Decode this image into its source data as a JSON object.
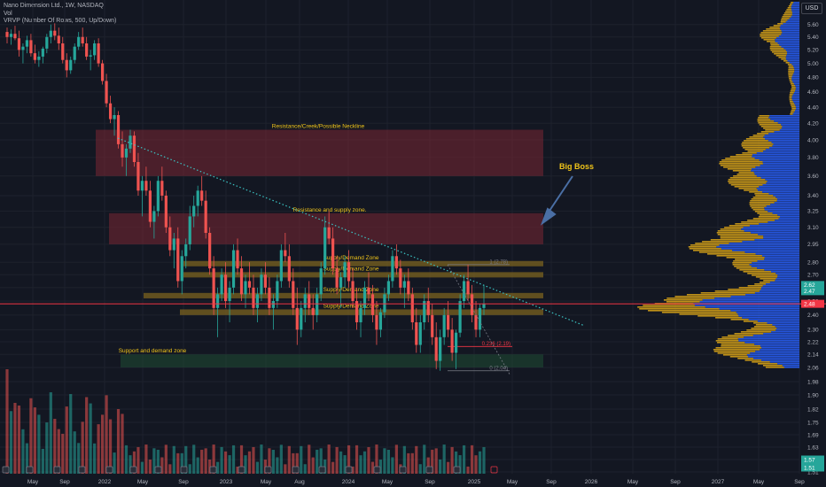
{
  "legend": {
    "symbol": "Nano Dimension Ltd., 1W, NASDAQ",
    "vol": "Vol",
    "vrvp": "VRVP (Number Of Rows, 500, Up/Down)"
  },
  "currency": "USD",
  "colors": {
    "bg": "#131722",
    "up": "#26a69a",
    "down": "#ef5350",
    "grid": "#1e222d",
    "zone_gold": "#8a6d1f",
    "zone_red": "#7a2633",
    "zone_green": "#1f4d33",
    "trend": "#3bc4c4",
    "price_line": "#f23645",
    "label": "#f0c419",
    "vp_up": "#2962ff",
    "vp_down": "#d4a017"
  },
  "chart_data": {
    "type": "candlestick",
    "y_ticks": [
      "5.60",
      "5.40",
      "5.20",
      "5.00",
      "4.80",
      "4.60",
      "4.40",
      "4.20",
      "4.00",
      "3.80",
      "3.60",
      "3.40",
      "3.25",
      "3.10",
      "2.95",
      "2.80",
      "2.70",
      "2.60",
      "2.50",
      "2.40",
      "2.30",
      "2.22",
      "2.14",
      "2.06",
      "1.98",
      "1.90",
      "1.82",
      "1.75",
      "1.69",
      "1.63",
      "1.57",
      "1.51"
    ],
    "x_ticks": [
      "May",
      "Sep",
      "2022",
      "May",
      "Sep",
      "2023",
      "May",
      "Aug",
      "2024",
      "May",
      "Sep",
      "2025",
      "May",
      "Sep",
      "2026",
      "May",
      "Sep",
      "2027",
      "May",
      "Sep"
    ],
    "ylim": [
      1.51,
      5.7
    ],
    "log_scale": true,
    "zones": [
      {
        "label": "Resistance/Creek/Possible Neckline",
        "from": 3.6,
        "to": 4.12,
        "color": "red"
      },
      {
        "label": "Resistance and supply zone.",
        "from": 2.95,
        "to": 3.23,
        "color": "red"
      },
      {
        "label": "Supply/Demand Zone",
        "from": 2.78,
        "to": 2.81,
        "color": "gold"
      },
      {
        "label": "Supply/Demand Zone",
        "from": 2.68,
        "to": 2.72,
        "color": "gold"
      },
      {
        "label": "Supply/Demand Zone",
        "from": 2.52,
        "to": 2.56,
        "color": "gold"
      },
      {
        "label": "Supply/Demand Zone",
        "from": 2.4,
        "to": 2.44,
        "color": "gold"
      },
      {
        "label": "Support and demand zone",
        "from": 2.06,
        "to": 2.14,
        "color": "green"
      }
    ],
    "fib_levels": [
      {
        "label": "1 (2.78)",
        "value": 2.78
      },
      {
        "label": "0.236 (2.19)",
        "value": 2.19
      },
      {
        "label": "0 (2.04)",
        "value": 2.04
      }
    ],
    "annotation": "Big Boss",
    "current_price": 2.48,
    "price_tags": [
      "2.62",
      "2.47",
      "2.48"
    ],
    "volume_tags": [
      "1.57",
      "1.51"
    ],
    "candles": [
      [
        5.48,
        5.55,
        5.3,
        5.4
      ],
      [
        5.4,
        5.52,
        5.28,
        5.45
      ],
      [
        5.45,
        5.58,
        5.35,
        5.38
      ],
      [
        5.38,
        5.5,
        5.1,
        5.2
      ],
      [
        5.2,
        5.3,
        5.0,
        5.25
      ],
      [
        5.25,
        5.42,
        5.15,
        5.35
      ],
      [
        5.35,
        5.45,
        5.1,
        5.15
      ],
      [
        5.15,
        5.28,
        5.0,
        5.05
      ],
      [
        5.05,
        5.18,
        4.95,
        5.1
      ],
      [
        5.1,
        5.25,
        5.0,
        5.22
      ],
      [
        5.22,
        5.45,
        5.15,
        5.4
      ],
      [
        5.4,
        5.6,
        5.3,
        5.5
      ],
      [
        5.5,
        5.62,
        5.35,
        5.42
      ],
      [
        5.42,
        5.55,
        5.2,
        5.3
      ],
      [
        5.3,
        5.4,
        5.0,
        5.05
      ],
      [
        5.05,
        5.15,
        4.8,
        4.9
      ],
      [
        4.9,
        5.1,
        4.85,
        5.05
      ],
      [
        5.05,
        5.3,
        5.0,
        5.25
      ],
      [
        5.25,
        5.48,
        5.2,
        5.4
      ],
      [
        5.4,
        5.55,
        5.25,
        5.3
      ],
      [
        5.3,
        5.4,
        5.05,
        5.1
      ],
      [
        5.1,
        5.2,
        4.9,
        5.12
      ],
      [
        5.12,
        5.35,
        5.05,
        5.3
      ],
      [
        5.3,
        5.38,
        4.95,
        5.0
      ],
      [
        5.0,
        5.05,
        4.7,
        4.75
      ],
      [
        4.75,
        4.85,
        4.4,
        4.45
      ],
      [
        4.45,
        4.55,
        4.2,
        4.25
      ],
      [
        4.25,
        4.4,
        4.05,
        4.3
      ],
      [
        4.3,
        4.35,
        3.9,
        3.95
      ],
      [
        3.95,
        4.1,
        3.7,
        3.8
      ],
      [
        3.8,
        3.95,
        3.6,
        3.9
      ],
      [
        3.9,
        4.12,
        3.85,
        4.05
      ],
      [
        4.05,
        4.1,
        3.7,
        3.75
      ],
      [
        3.75,
        3.85,
        3.4,
        3.45
      ],
      [
        3.45,
        3.6,
        3.2,
        3.55
      ],
      [
        3.55,
        3.7,
        3.4,
        3.45
      ],
      [
        3.45,
        3.55,
        3.1,
        3.15
      ],
      [
        3.15,
        3.3,
        3.0,
        3.25
      ],
      [
        3.25,
        3.6,
        3.2,
        3.55
      ],
      [
        3.55,
        3.7,
        3.35,
        3.4
      ],
      [
        3.4,
        3.45,
        3.05,
        3.1
      ],
      [
        3.1,
        3.2,
        2.85,
        2.9
      ],
      [
        2.9,
        3.05,
        2.75,
        3.0
      ],
      [
        3.0,
        3.1,
        2.6,
        2.65
      ],
      [
        2.65,
        2.9,
        2.55,
        2.85
      ],
      [
        2.85,
        3.0,
        2.75,
        2.95
      ],
      [
        2.95,
        3.3,
        2.9,
        3.2
      ],
      [
        3.2,
        3.4,
        3.1,
        3.3
      ],
      [
        3.3,
        3.5,
        3.2,
        3.45
      ],
      [
        3.45,
        3.6,
        3.3,
        3.35
      ],
      [
        3.35,
        3.45,
        3.0,
        3.05
      ],
      [
        3.05,
        3.1,
        2.7,
        2.75
      ],
      [
        2.75,
        2.85,
        2.4,
        2.45
      ],
      [
        2.45,
        2.6,
        2.25,
        2.55
      ],
      [
        2.55,
        2.75,
        2.5,
        2.7
      ],
      [
        2.7,
        2.8,
        2.45,
        2.5
      ],
      [
        2.5,
        2.65,
        2.35,
        2.6
      ],
      [
        2.6,
        2.95,
        2.55,
        2.9
      ],
      [
        2.9,
        3.0,
        2.7,
        2.75
      ],
      [
        2.75,
        2.85,
        2.5,
        2.55
      ],
      [
        2.55,
        2.7,
        2.45,
        2.65
      ],
      [
        2.65,
        2.8,
        2.55,
        2.6
      ],
      [
        2.6,
        2.7,
        2.4,
        2.45
      ],
      [
        2.45,
        2.6,
        2.35,
        2.55
      ],
      [
        2.55,
        2.75,
        2.5,
        2.7
      ],
      [
        2.7,
        2.8,
        2.55,
        2.6
      ],
      [
        2.6,
        2.68,
        2.4,
        2.45
      ],
      [
        2.45,
        2.55,
        2.3,
        2.5
      ],
      [
        2.5,
        2.7,
        2.45,
        2.65
      ],
      [
        2.65,
        2.95,
        2.6,
        2.9
      ],
      [
        2.9,
        3.05,
        2.8,
        2.85
      ],
      [
        2.85,
        2.95,
        2.6,
        2.65
      ],
      [
        2.65,
        2.75,
        2.4,
        2.45
      ],
      [
        2.45,
        2.6,
        2.2,
        2.3
      ],
      [
        2.3,
        2.5,
        2.25,
        2.45
      ],
      [
        2.45,
        2.6,
        2.35,
        2.55
      ],
      [
        2.55,
        2.65,
        2.4,
        2.45
      ],
      [
        2.45,
        2.55,
        2.3,
        2.4
      ],
      [
        2.4,
        2.6,
        2.35,
        2.55
      ],
      [
        2.55,
        2.8,
        2.5,
        2.75
      ],
      [
        2.75,
        3.2,
        2.7,
        3.1
      ],
      [
        3.1,
        3.25,
        2.95,
        3.0
      ],
      [
        3.0,
        3.1,
        2.7,
        2.75
      ],
      [
        2.75,
        2.85,
        2.55,
        2.6
      ],
      [
        2.6,
        2.72,
        2.45,
        2.68
      ],
      [
        2.68,
        2.85,
        2.6,
        2.8
      ],
      [
        2.8,
        2.9,
        2.6,
        2.65
      ],
      [
        2.65,
        2.75,
        2.45,
        2.5
      ],
      [
        2.5,
        2.6,
        2.3,
        2.35
      ],
      [
        2.35,
        2.5,
        2.25,
        2.45
      ],
      [
        2.45,
        2.65,
        2.4,
        2.6
      ],
      [
        2.6,
        2.72,
        2.5,
        2.55
      ],
      [
        2.55,
        2.62,
        2.35,
        2.4
      ],
      [
        2.4,
        2.5,
        2.2,
        2.3
      ],
      [
        2.3,
        2.45,
        2.25,
        2.42
      ],
      [
        2.42,
        2.6,
        2.38,
        2.55
      ],
      [
        2.55,
        2.7,
        2.5,
        2.65
      ],
      [
        2.65,
        2.9,
        2.6,
        2.85
      ],
      [
        2.85,
        2.95,
        2.7,
        2.75
      ],
      [
        2.75,
        2.82,
        2.55,
        2.6
      ],
      [
        2.6,
        2.7,
        2.45,
        2.65
      ],
      [
        2.65,
        2.75,
        2.5,
        2.55
      ],
      [
        2.55,
        2.6,
        2.3,
        2.35
      ],
      [
        2.35,
        2.45,
        2.15,
        2.2
      ],
      [
        2.2,
        2.4,
        2.15,
        2.35
      ],
      [
        2.35,
        2.55,
        2.3,
        2.5
      ],
      [
        2.5,
        2.6,
        2.35,
        2.4
      ],
      [
        2.4,
        2.48,
        2.2,
        2.25
      ],
      [
        2.25,
        2.35,
        2.05,
        2.1
      ],
      [
        2.1,
        2.3,
        2.04,
        2.25
      ],
      [
        2.25,
        2.45,
        2.2,
        2.4
      ],
      [
        2.4,
        2.5,
        2.25,
        2.3
      ],
      [
        2.3,
        2.38,
        2.1,
        2.15
      ],
      [
        2.15,
        2.3,
        2.05,
        2.28
      ],
      [
        2.28,
        2.55,
        2.25,
        2.5
      ],
      [
        2.5,
        2.7,
        2.45,
        2.65
      ],
      [
        2.65,
        2.78,
        2.5,
        2.55
      ],
      [
        2.55,
        2.62,
        2.35,
        2.4
      ],
      [
        2.4,
        2.5,
        2.25,
        2.3
      ],
      [
        2.3,
        2.48,
        2.25,
        2.45
      ],
      [
        2.45,
        2.62,
        2.4,
        2.48
      ]
    ]
  }
}
